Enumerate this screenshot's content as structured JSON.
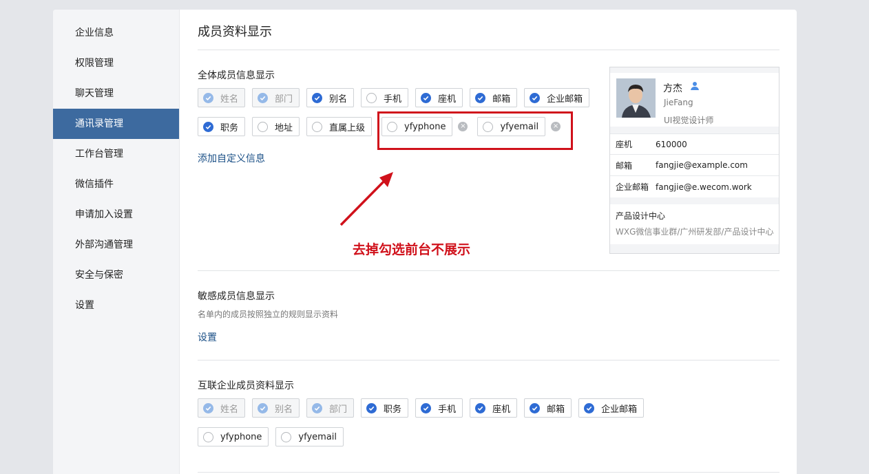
{
  "sidebar": {
    "items": [
      {
        "label": "企业信息",
        "active": false
      },
      {
        "label": "权限管理",
        "active": false
      },
      {
        "label": "聊天管理",
        "active": false
      },
      {
        "label": "通讯录管理",
        "active": true
      },
      {
        "label": "工作台管理",
        "active": false
      },
      {
        "label": "微信插件",
        "active": false
      },
      {
        "label": "申请加入设置",
        "active": false
      },
      {
        "label": "外部沟通管理",
        "active": false
      },
      {
        "label": "安全与保密",
        "active": false
      },
      {
        "label": "设置",
        "active": false
      }
    ]
  },
  "page": {
    "title": "成员资料显示"
  },
  "all_members": {
    "title": "全体成员信息显示",
    "row1": [
      {
        "label": "姓名",
        "state": "disabled"
      },
      {
        "label": "部门",
        "state": "disabled"
      },
      {
        "label": "别名",
        "state": "checked"
      },
      {
        "label": "手机",
        "state": "unchecked"
      },
      {
        "label": "座机",
        "state": "checked"
      },
      {
        "label": "邮箱",
        "state": "checked"
      },
      {
        "label": "企业邮箱",
        "state": "checked"
      }
    ],
    "row2": [
      {
        "label": "职务",
        "state": "checked"
      },
      {
        "label": "地址",
        "state": "unchecked"
      },
      {
        "label": "直属上级",
        "state": "unchecked"
      }
    ],
    "custom": [
      {
        "label": "yfyphone",
        "state": "unchecked"
      },
      {
        "label": "yfyemail",
        "state": "unchecked"
      }
    ],
    "add_link": "添加自定义信息"
  },
  "annotation": {
    "text": "去掉勾选前台不展示",
    "color": "#d0111b"
  },
  "card": {
    "name": "方杰",
    "en_name": "JieFang",
    "job_title": "UI视觉设计师",
    "rows": [
      {
        "key": "座机",
        "value": "610000"
      },
      {
        "key": "邮箱",
        "value": "fangjie@example.com"
      },
      {
        "key": "企业邮箱",
        "value": "fangjie@e.wecom.work"
      }
    ],
    "dept": "产品设计中心",
    "dept_path": "WXG微信事业群/广州研发部/产品设计中心"
  },
  "sensitive": {
    "title": "敏感成员信息显示",
    "desc": "名单内的成员按照独立的规则显示资料",
    "link": "设置"
  },
  "linked": {
    "title": "互联企业成员资料显示",
    "row1": [
      {
        "label": "姓名",
        "state": "disabled"
      },
      {
        "label": "别名",
        "state": "disabled"
      },
      {
        "label": "部门",
        "state": "disabled"
      },
      {
        "label": "职务",
        "state": "checked"
      },
      {
        "label": "手机",
        "state": "checked"
      },
      {
        "label": "座机",
        "state": "checked"
      },
      {
        "label": "邮箱",
        "state": "checked"
      },
      {
        "label": "企业邮箱",
        "state": "checked"
      }
    ],
    "row2": [
      {
        "label": "yfyphone",
        "state": "unchecked"
      },
      {
        "label": "yfyemail",
        "state": "unchecked"
      }
    ]
  },
  "colors": {
    "accent": "#3d6a9f",
    "check": "#2e6bd4",
    "link": "#1a4f86",
    "annotation": "#d0111b"
  }
}
